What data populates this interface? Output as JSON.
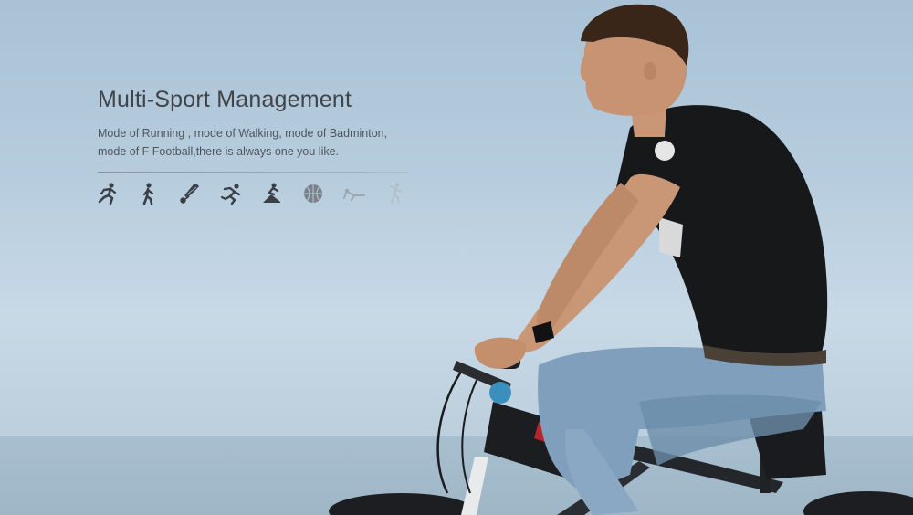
{
  "headline": "Multi-Sport Management",
  "description_lines": [
    "Mode of Running , mode of Walking, mode of Badminton,",
    "mode of F Football,there is always one you like."
  ],
  "sport_icons": [
    "running-icon",
    "walking-icon",
    "badminton-shuttlecock-icon",
    "sprinting-icon",
    "climbing-icon",
    "basketball-icon",
    "yoga-stretch-icon",
    "fitness-icon"
  ],
  "colors": {
    "sky": "#b7cdde",
    "text_dark": "#404448",
    "icon_dark": "#3a3f45",
    "icon_light": "#b5bdc4"
  }
}
